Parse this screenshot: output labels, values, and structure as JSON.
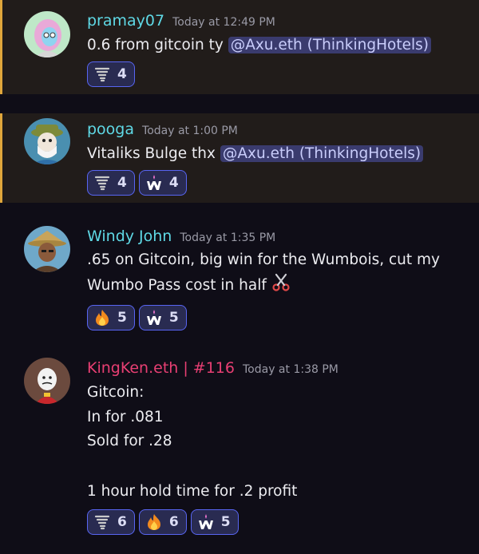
{
  "messages": [
    {
      "username": "pramay07",
      "user_color": "#5fd9e6",
      "timestamp": "Today at 12:49 PM",
      "text_before": "0.6 from gitcoin ty ",
      "mention": "@Axu.eth (ThinkingHotels)",
      "reactions": [
        {
          "emoji": "tornado-icon",
          "count": "4"
        }
      ]
    },
    {
      "username": "pooga",
      "user_color": "#5fd9e6",
      "timestamp": "Today at 1:00 PM",
      "text_before": "Vitaliks Bulge thx ",
      "mention": "@Axu.eth (ThinkingHotels)",
      "reactions": [
        {
          "emoji": "tornado-icon",
          "count": "4"
        },
        {
          "emoji": "wumbo-w-icon",
          "count": "4"
        }
      ]
    },
    {
      "username": "Windy John",
      "user_color": "#5fd9e6",
      "timestamp": "Today at 1:35 PM",
      "lines": [
        ".65 on Gitcoin, big win for the Wumbois, cut my",
        "Wumbo Pass cost in half "
      ],
      "inline_emoji": "scissors-icon",
      "reactions": [
        {
          "emoji": "fire-icon",
          "count": "5"
        },
        {
          "emoji": "wumbo-w-icon",
          "count": "5"
        }
      ]
    },
    {
      "username": "KingKen.eth | #116",
      "user_color": "#e83f73",
      "timestamp": "Today at 1:38 PM",
      "lines": [
        "Gitcoin:",
        "In for .081",
        "Sold for .28",
        "",
        "1 hour hold time for .2 profit"
      ],
      "reactions": [
        {
          "emoji": "tornado-icon",
          "count": "6"
        },
        {
          "emoji": "fire-icon",
          "count": "6"
        },
        {
          "emoji": "wumbo-w-icon",
          "count": "5"
        }
      ]
    }
  ],
  "colors": {
    "background": "#0f0d17",
    "highlight_bg": "#211c1a",
    "highlight_border": "#e0a63b",
    "mention_bg": "#3a3b6e",
    "reaction_border": "#5865f2"
  }
}
